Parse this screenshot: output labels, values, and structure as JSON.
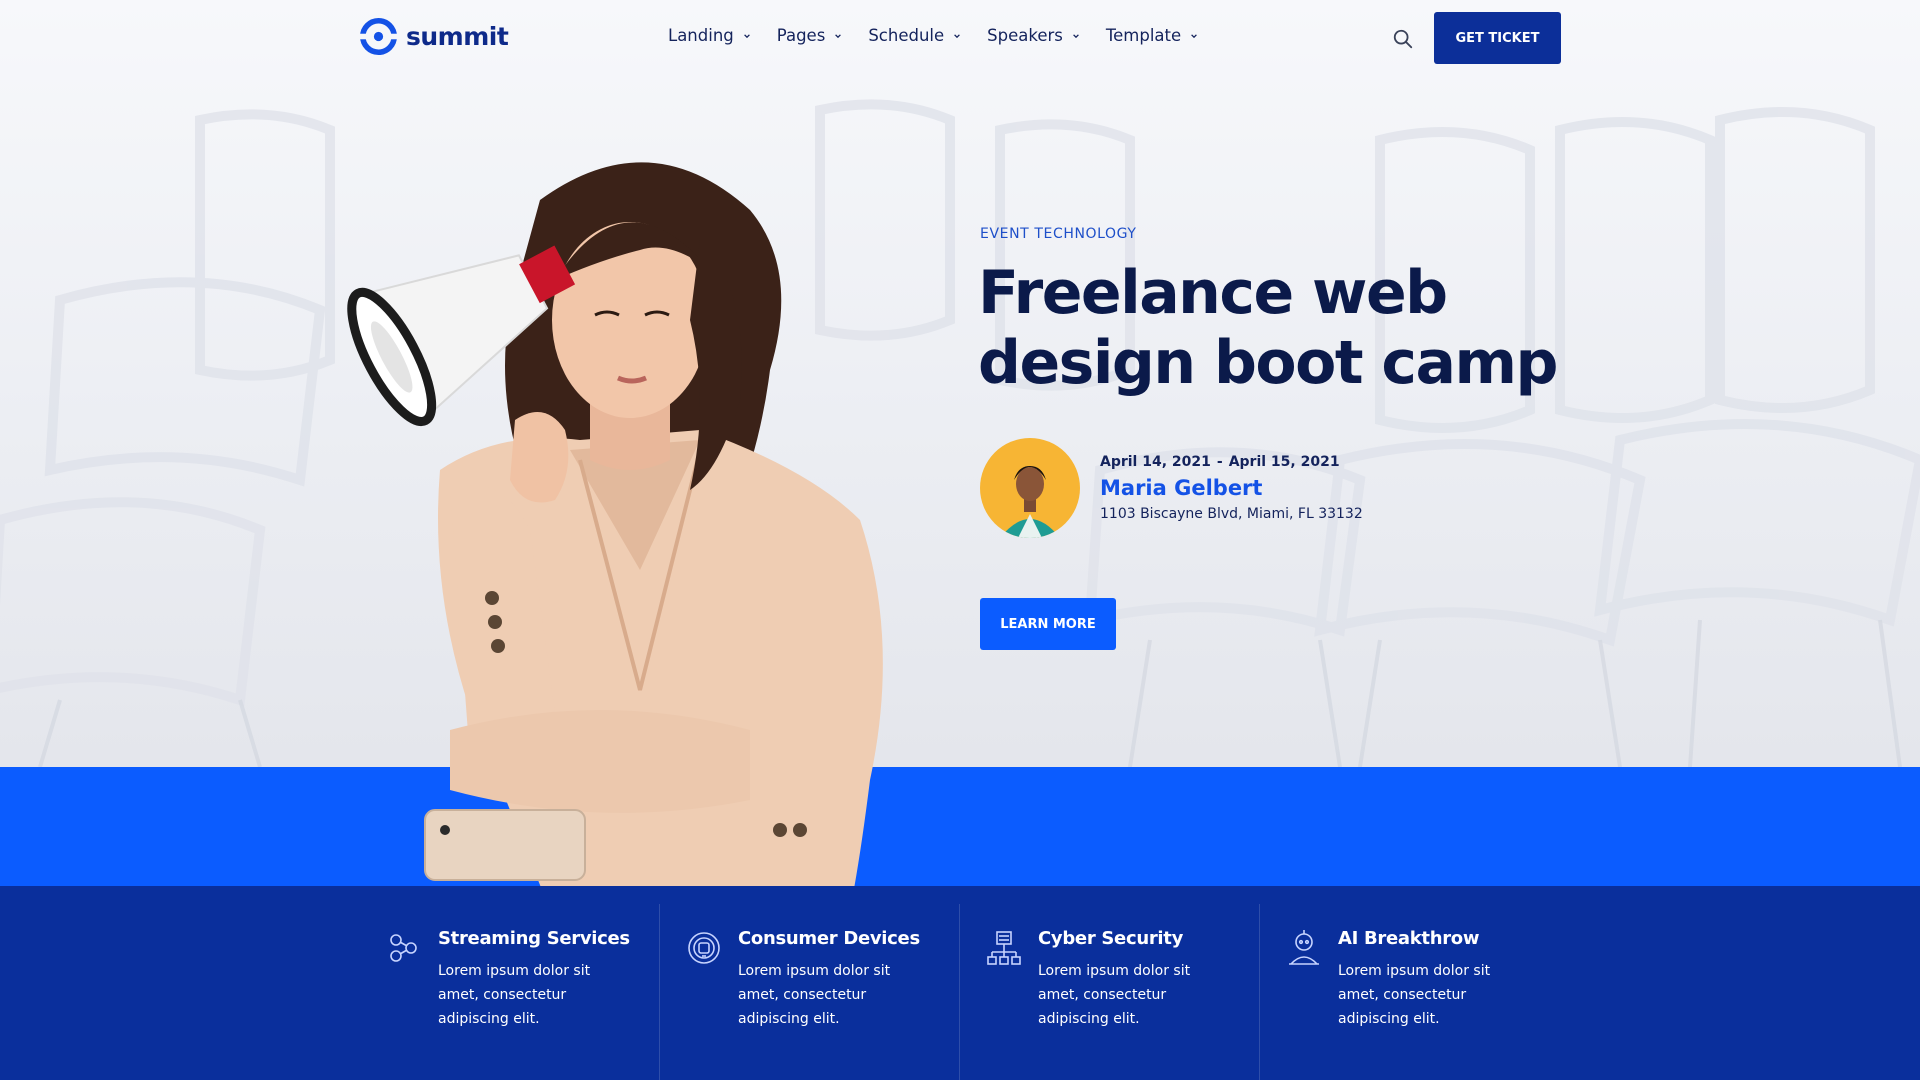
{
  "brand": {
    "name": "summit",
    "color": "#1452e6"
  },
  "nav": {
    "items": [
      {
        "label": "Landing"
      },
      {
        "label": "Pages"
      },
      {
        "label": "Schedule"
      },
      {
        "label": "Speakers"
      },
      {
        "label": "Template"
      }
    ],
    "search_icon": "search-icon",
    "ticket_label": "GET TICKET"
  },
  "hero": {
    "eyebrow": "EVENT TECHNOLOGY",
    "headline": "Freelance web design boot camp",
    "speaker": {
      "date_start": "April 14, 2021",
      "separator": "-",
      "date_end": "April 15, 2021",
      "name": "Maria Gelbert",
      "address": "1103 Biscayne Blvd, Miami, FL 33132"
    },
    "cta_label": "LEARN MORE"
  },
  "features": [
    {
      "icon": "streaming-icon",
      "title": "Streaming Services",
      "text": "Lorem ipsum dolor sit amet, consectetur adipiscing elit."
    },
    {
      "icon": "device-icon",
      "title": "Consumer Devices",
      "text": "Lorem ipsum dolor sit amet, consectetur adipiscing elit."
    },
    {
      "icon": "network-icon",
      "title": "Cyber Security",
      "text": "Lorem ipsum dolor sit amet, consectetur adipiscing elit."
    },
    {
      "icon": "ai-head-icon",
      "title": "AI Breakthrow",
      "text": "Lorem ipsum dolor sit amet, consectetur adipiscing elit."
    }
  ],
  "colors": {
    "primary_dark": "#0a2f9c",
    "primary_bright": "#0b5cff",
    "heading": "#0b1a4a"
  }
}
